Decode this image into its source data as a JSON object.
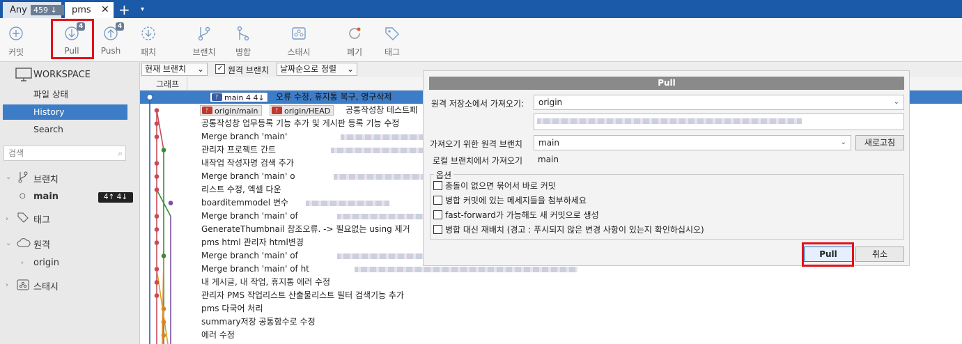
{
  "tabs": {
    "any": {
      "label": "Any",
      "badge": "459 ↓"
    },
    "pms": {
      "label": "pms",
      "close": "✕"
    },
    "add": "+",
    "menu": "▾"
  },
  "toolbar": {
    "commit": "커밋",
    "pull": "Pull",
    "pull_count": "4",
    "push": "Push",
    "push_count": "4",
    "patch": "패치",
    "branch": "브랜치",
    "merge": "병합",
    "stash": "스태시",
    "discard": "폐기",
    "tag": "태그"
  },
  "sidebar": {
    "workspace": "WORKSPACE",
    "file_status": "파일 상태",
    "history": "History",
    "search": "Search",
    "search_placeholder": "검색",
    "branches": "브랜치",
    "branch_main": "main",
    "branch_main_ahead": "4↑ 4↓",
    "tags": "태그",
    "remotes": "원격",
    "remote_origin": "origin",
    "stashes": "스태시"
  },
  "filter": {
    "branch_filter": "현재 브랜치",
    "remote_branches": "원격 브랜치",
    "remote_branches_checked": true,
    "sort": "날짜순으로 정렬"
  },
  "history": {
    "graph_header": "그래프",
    "rows": [
      {
        "msg": "오류 수정, 휴지통 복구, 영구삭제",
        "tags": [
          "main 4 4↓"
        ]
      },
      {
        "msg": "공통작성창 테스트페",
        "tags": [
          "origin/main",
          "origin/HEAD"
        ]
      },
      {
        "msg": "공통작성창 업무등록 기능 추가 및 게시판 등록 기능 수정"
      },
      {
        "msg": "Merge branch 'main'"
      },
      {
        "msg": "관리자 프로젝트 간트"
      },
      {
        "msg": "내작업 작성자명 검색 추가"
      },
      {
        "msg": "Merge branch 'main' o"
      },
      {
        "msg": "리스트 수정, 엑셀 다운"
      },
      {
        "msg": "boarditemmodel 변수"
      },
      {
        "msg": "Merge branch 'main' of"
      },
      {
        "msg": "GenerateThumbnail 참조오류. -> 필요없는 using 제거"
      },
      {
        "msg": "pms html 관리자 html변경"
      },
      {
        "msg": "Merge branch 'main' of"
      },
      {
        "msg": "Merge branch 'main' of ht"
      },
      {
        "msg": "내 게시글, 내 작업, 휴지통 에러 수정"
      },
      {
        "msg": "관리자 PMS 작업리스트 산출물리스트 필터 검색기능 추가"
      },
      {
        "msg": "pms 다국어 처리"
      },
      {
        "msg": "summary저장 공통함수로 수정"
      },
      {
        "msg": "에러 수정"
      }
    ]
  },
  "dialog": {
    "title": "Pull",
    "remote_label": "원격 저장소에서 가져오기:",
    "remote_value": "origin",
    "remote_branch_label": "가져오기 위한 원격 브랜치",
    "remote_branch_value": "main",
    "refresh": "새로고침",
    "local_label": "로컬 브랜치에서 가져오기",
    "local_value": "main",
    "options_legend": "옵션",
    "opt1": "충돌이 없으면 묶어서 바로 커밋",
    "opt2": "병합 커밋에 있는 메세지들을 첨부하세요",
    "opt3": "fast-forward가 가능해도 새 커밋으로 생성",
    "opt4": "병합 대신 재배치 (경고 : 푸시되지 않은 변경 사항이 있는지 확인하십시오)",
    "ok": "Pull",
    "cancel": "취소"
  }
}
